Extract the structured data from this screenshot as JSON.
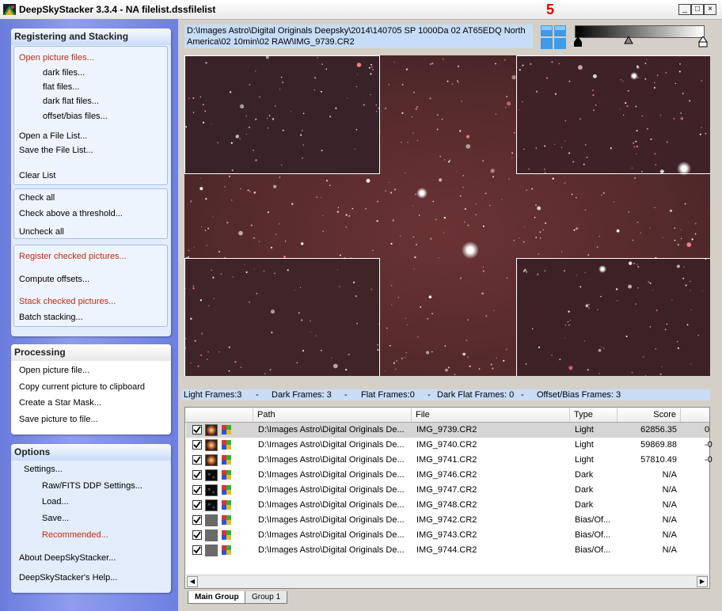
{
  "window": {
    "title": "DeepSkyStacker 3.3.4 - NA filelist.dssfilelist",
    "badge": "5",
    "buttons": {
      "minimize": "_",
      "maximize": "□",
      "close": "×"
    }
  },
  "sidebar": {
    "registering": {
      "title": "Registering and Stacking",
      "open_pictures": "Open picture files...",
      "dark": "dark files...",
      "flat": "flat files...",
      "dark_flat": "dark flat files...",
      "offset_bias": "offset/bias files...",
      "open_list": "Open a File List...",
      "save_list": "Save the File List...",
      "clear_list": "Clear List",
      "check_all": "Check all",
      "check_above": "Check above a threshold...",
      "uncheck_all": "Uncheck all",
      "register_checked": "Register checked pictures...",
      "compute_offsets": "Compute offsets...",
      "stack_checked": "Stack checked pictures...",
      "batch_stacking": "Batch stacking..."
    },
    "processing": {
      "title": "Processing",
      "open_picture": "Open picture file...",
      "copy_clipboard": "Copy current picture to clipboard",
      "star_mask": "Create a Star Mask...",
      "save_picture": "Save picture to file..."
    },
    "options": {
      "title": "Options",
      "settings": "Settings...",
      "raw_fits": "Raw/FITS DDP Settings...",
      "load": "Load...",
      "save": "Save...",
      "recommended": "Recommended...",
      "about": "About DeepSkyStacker...",
      "help": "DeepSkyStacker's Help..."
    }
  },
  "viewer": {
    "path": "D:\\Images Astro\\Digital Originals Deepsky\\2014\\140705 SP 1000Da 02 AT65EDQ North America\\02 10min\\02 RAW\\IMG_9739.CR2"
  },
  "stats": {
    "light": "Light Frames:3",
    "dark": "Dark Frames: 3",
    "flat": "Flat Frames:0",
    "dark_flat": "Dark Flat Frames: 0",
    "offset": "Offset/Bias Frames: 3",
    "sep": "-"
  },
  "list": {
    "columns": [
      "Path",
      "File",
      "Type",
      "Score"
    ],
    "rows": [
      {
        "path": "D:\\Images Astro\\Digital Originals De...",
        "file": "IMG_9739.CR2",
        "type": "Light",
        "score": "62856.35",
        "extra": "0",
        "thumb": "light",
        "selected": true
      },
      {
        "path": "D:\\Images Astro\\Digital Originals De...",
        "file": "IMG_9740.CR2",
        "type": "Light",
        "score": "59869.88",
        "extra": "-0",
        "thumb": "light"
      },
      {
        "path": "D:\\Images Astro\\Digital Originals De...",
        "file": "IMG_9741.CR2",
        "type": "Light",
        "score": "57810.49",
        "extra": "-0",
        "thumb": "light"
      },
      {
        "path": "D:\\Images Astro\\Digital Originals De...",
        "file": "IMG_9746.CR2",
        "type": "Dark",
        "score": "N/A",
        "extra": "",
        "thumb": "dark"
      },
      {
        "path": "D:\\Images Astro\\Digital Originals De...",
        "file": "IMG_9747.CR2",
        "type": "Dark",
        "score": "N/A",
        "extra": "",
        "thumb": "dark"
      },
      {
        "path": "D:\\Images Astro\\Digital Originals De...",
        "file": "IMG_9748.CR2",
        "type": "Dark",
        "score": "N/A",
        "extra": "",
        "thumb": "dark"
      },
      {
        "path": "D:\\Images Astro\\Digital Originals De...",
        "file": "IMG_9742.CR2",
        "type": "Bias/Of...",
        "score": "N/A",
        "extra": "",
        "thumb": "bias"
      },
      {
        "path": "D:\\Images Astro\\Digital Originals De...",
        "file": "IMG_9743.CR2",
        "type": "Bias/Of...",
        "score": "N/A",
        "extra": "",
        "thumb": "bias"
      },
      {
        "path": "D:\\Images Astro\\Digital Originals De...",
        "file": "IMG_9744.CR2",
        "type": "Bias/Of...",
        "score": "N/A",
        "extra": "",
        "thumb": "bias"
      }
    ]
  },
  "tabs": [
    "Main Group",
    "Group 1"
  ],
  "colors": {
    "accent_red": "#c22a14",
    "panel_blue": "#e3ecfb",
    "nebula": "#5a2a2c"
  }
}
